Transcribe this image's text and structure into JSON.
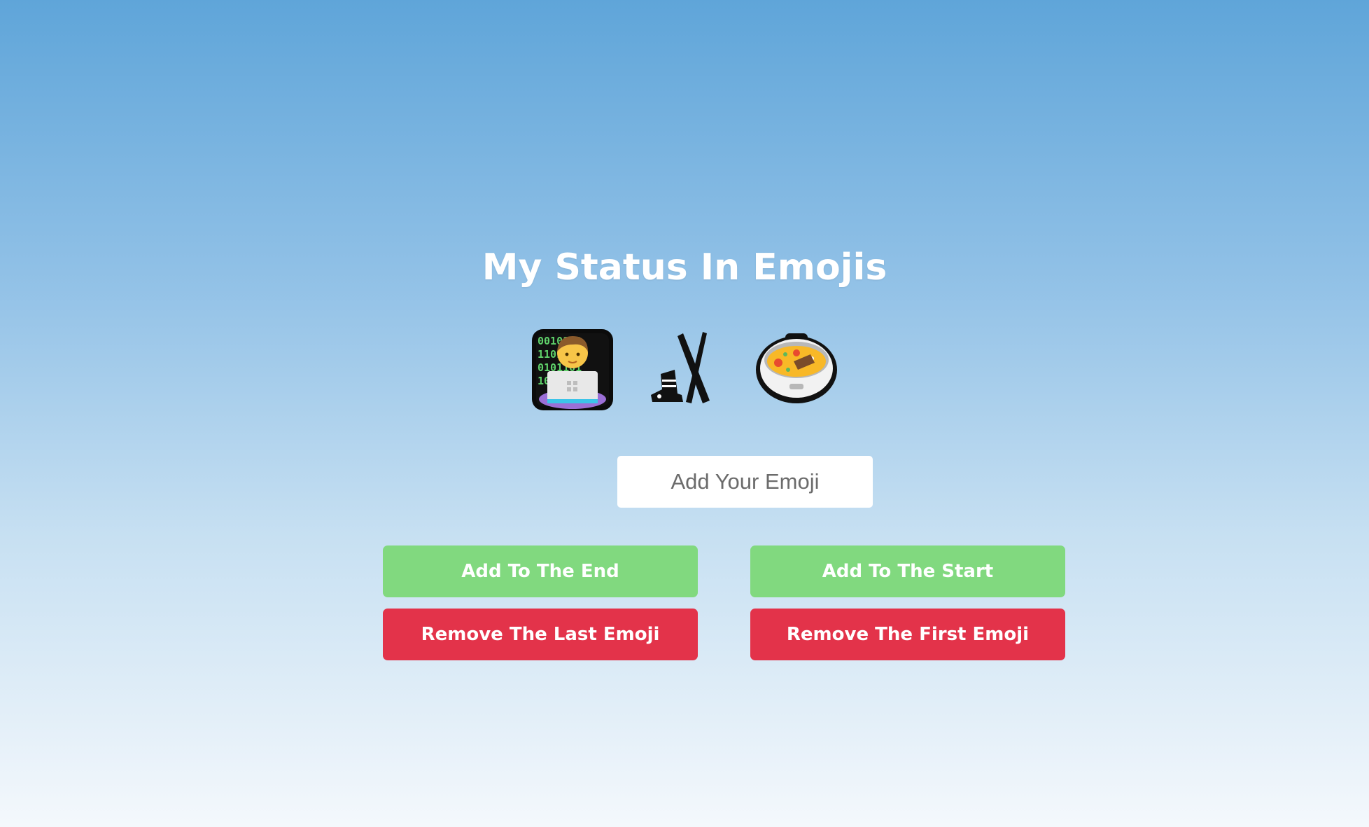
{
  "page": {
    "title": "My Status In Emojis"
  },
  "emojis": [
    {
      "icon": "technologist-icon",
      "glyph": "🧑‍💻"
    },
    {
      "icon": "ski-icon",
      "glyph": "🎿"
    },
    {
      "icon": "pot-of-food-icon",
      "glyph": "🍲"
    }
  ],
  "input": {
    "placeholder": "Add Your Emoji",
    "value": ""
  },
  "buttons": {
    "add_end": "Add To The End",
    "add_start": "Add To The Start",
    "remove_last": "Remove The Last Emoji",
    "remove_first": "Remove The First Emoji"
  },
  "colors": {
    "add_button": "#81d97f",
    "remove_button": "#e3334a",
    "title_text": "#ffffff"
  }
}
